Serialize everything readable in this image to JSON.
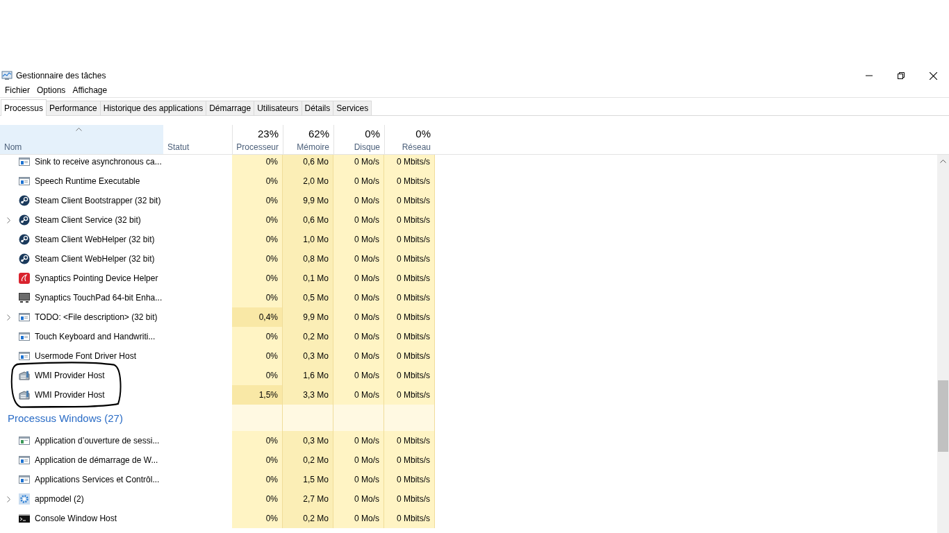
{
  "window": {
    "title": "Gestionnaire des tâches"
  },
  "menu": [
    "Fichier",
    "Options",
    "Affichage"
  ],
  "tabs": [
    {
      "label": "Processus",
      "selected": true
    },
    {
      "label": "Performance",
      "selected": false
    },
    {
      "label": "Historique des applications",
      "selected": false
    },
    {
      "label": "Démarrage",
      "selected": false
    },
    {
      "label": "Utilisateurs",
      "selected": false
    },
    {
      "label": "Détails",
      "selected": false
    },
    {
      "label": "Services",
      "selected": false
    }
  ],
  "columns": [
    {
      "label": "Nom",
      "sorted": true
    },
    {
      "label": "Statut",
      "sorted": false
    },
    {
      "label": "Processeur",
      "total": "23%",
      "sorted": false
    },
    {
      "label": "Mémoire",
      "total": "62%",
      "sorted": false
    },
    {
      "label": "Disque",
      "total": "0%",
      "sorted": false
    },
    {
      "label": "Réseau",
      "total": "0%",
      "sorted": false
    }
  ],
  "rows": [
    {
      "kind": "app",
      "name": "Sink to receive asynchronous ca...",
      "expandable": false,
      "cpu_busy": false,
      "circled": false,
      "cpu": "0%",
      "memory": "0,6 Mo",
      "disk": "0 Mo/s",
      "network": "0 Mbits/s"
    },
    {
      "kind": "app",
      "name": "Speech Runtime Executable",
      "expandable": false,
      "cpu_busy": false,
      "circled": false,
      "cpu": "0%",
      "memory": "2,0 Mo",
      "disk": "0 Mo/s",
      "network": "0 Mbits/s"
    },
    {
      "kind": "steam",
      "name": "Steam Client Bootstrapper (32 bit)",
      "expandable": false,
      "cpu_busy": false,
      "circled": false,
      "cpu": "0%",
      "memory": "9,9 Mo",
      "disk": "0 Mo/s",
      "network": "0 Mbits/s"
    },
    {
      "kind": "steam",
      "name": "Steam Client Service (32 bit)",
      "expandable": true,
      "cpu_busy": false,
      "circled": false,
      "cpu": "0%",
      "memory": "0,6 Mo",
      "disk": "0 Mo/s",
      "network": "0 Mbits/s"
    },
    {
      "kind": "steam",
      "name": "Steam Client WebHelper (32 bit)",
      "expandable": false,
      "cpu_busy": false,
      "circled": false,
      "cpu": "0%",
      "memory": "1,0 Mo",
      "disk": "0 Mo/s",
      "network": "0 Mbits/s"
    },
    {
      "kind": "steam",
      "name": "Steam Client WebHelper (32 bit)",
      "expandable": false,
      "cpu_busy": false,
      "circled": false,
      "cpu": "0%",
      "memory": "0,8 Mo",
      "disk": "0 Mo/s",
      "network": "0 Mbits/s"
    },
    {
      "kind": "synaptics",
      "name": "Synaptics Pointing Device Helper",
      "expandable": false,
      "cpu_busy": false,
      "circled": false,
      "cpu": "0%",
      "memory": "0,1 Mo",
      "disk": "0 Mo/s",
      "network": "0 Mbits/s"
    },
    {
      "kind": "monitor",
      "name": "Synaptics TouchPad 64-bit Enha...",
      "expandable": false,
      "cpu_busy": false,
      "circled": false,
      "cpu": "0%",
      "memory": "0,5 Mo",
      "disk": "0 Mo/s",
      "network": "0 Mbits/s"
    },
    {
      "kind": "app",
      "name": "TODO: <File description> (32 bit)",
      "expandable": true,
      "cpu_busy": true,
      "circled": false,
      "cpu": "0,4%",
      "memory": "9,9 Mo",
      "disk": "0 Mo/s",
      "network": "0 Mbits/s"
    },
    {
      "kind": "app",
      "name": "Touch Keyboard and Handwriti...",
      "expandable": false,
      "cpu_busy": false,
      "circled": false,
      "cpu": "0%",
      "memory": "0,2 Mo",
      "disk": "0 Mo/s",
      "network": "0 Mbits/s"
    },
    {
      "kind": "app",
      "name": "Usermode Font Driver Host",
      "expandable": false,
      "cpu_busy": false,
      "circled": false,
      "cpu": "0%",
      "memory": "0,3 Mo",
      "disk": "0 Mo/s",
      "network": "0 Mbits/s"
    },
    {
      "kind": "wmi",
      "name": "WMI Provider Host",
      "expandable": false,
      "cpu_busy": false,
      "circled": true,
      "cpu": "0%",
      "memory": "1,6 Mo",
      "disk": "0 Mo/s",
      "network": "0 Mbits/s"
    },
    {
      "kind": "wmi",
      "name": "WMI Provider Host",
      "expandable": false,
      "cpu_busy": true,
      "circled": true,
      "cpu": "1,5%",
      "memory": "3,3 Mo",
      "disk": "0 Mo/s",
      "network": "0 Mbits/s"
    },
    {
      "kind": "group",
      "name": "Processus Windows (27)"
    },
    {
      "kind": "system",
      "name": "Application d’ouverture de sessi...",
      "expandable": false,
      "cpu_busy": false,
      "circled": false,
      "cpu": "0%",
      "memory": "0,3 Mo",
      "disk": "0 Mo/s",
      "network": "0 Mbits/s"
    },
    {
      "kind": "app",
      "name": "Application de démarrage de W...",
      "expandable": false,
      "cpu_busy": false,
      "circled": false,
      "cpu": "0%",
      "memory": "0,2 Mo",
      "disk": "0 Mo/s",
      "network": "0 Mbits/s"
    },
    {
      "kind": "app",
      "name": "Applications Services et Contrôl...",
      "expandable": false,
      "cpu_busy": false,
      "circled": false,
      "cpu": "0%",
      "memory": "1,5 Mo",
      "disk": "0 Mo/s",
      "network": "0 Mbits/s"
    },
    {
      "kind": "gear",
      "name": "appmodel (2)",
      "expandable": true,
      "cpu_busy": false,
      "circled": false,
      "cpu": "0%",
      "memory": "2,7 Mo",
      "disk": "0 Mo/s",
      "network": "0 Mbits/s"
    },
    {
      "kind": "console",
      "name": "Console Window Host",
      "expandable": false,
      "cpu_busy": false,
      "circled": false,
      "cpu": "0%",
      "memory": "0,2 Mo",
      "disk": "0 Mo/s",
      "network": "0 Mbits/s"
    }
  ]
}
